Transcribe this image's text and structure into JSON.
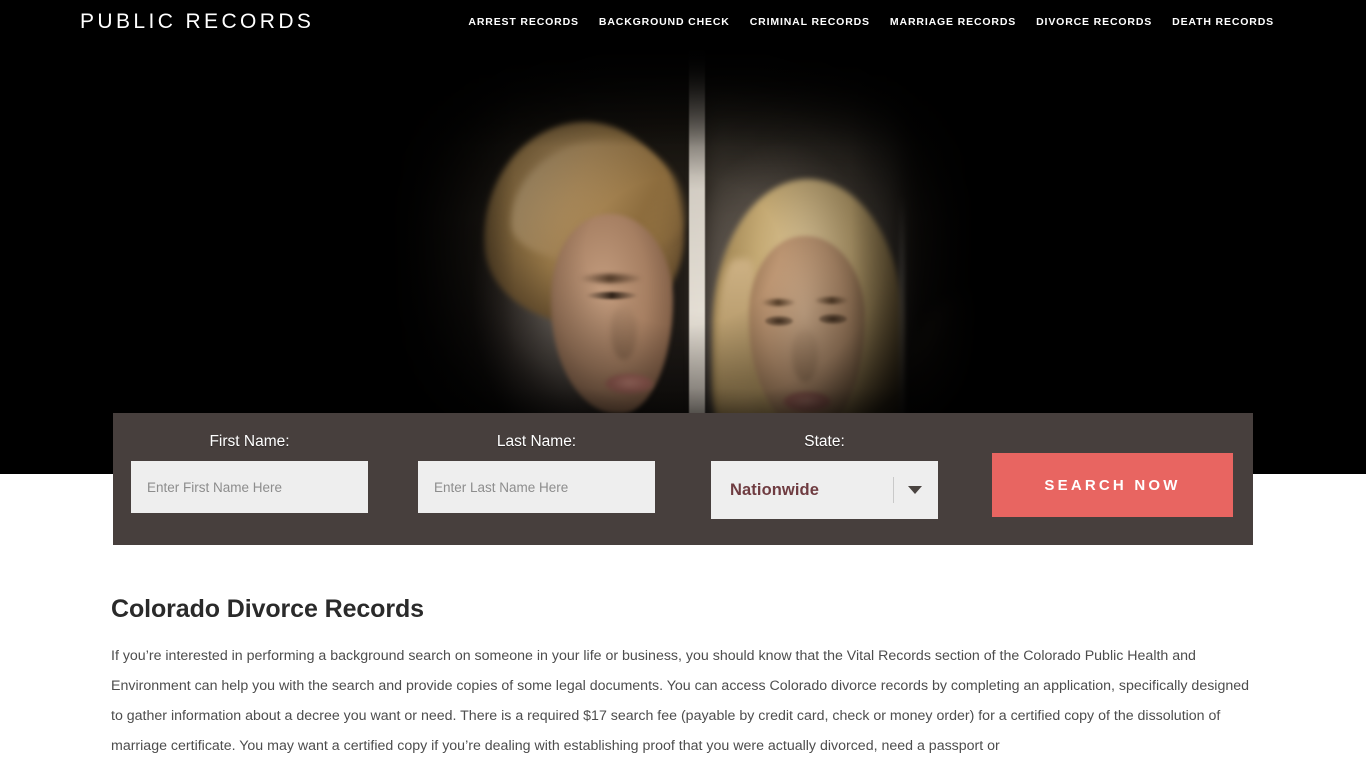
{
  "header": {
    "brand": "PUBLIC RECORDS",
    "nav": [
      {
        "label": "ARREST RECORDS"
      },
      {
        "label": "BACKGROUND CHECK"
      },
      {
        "label": "CRIMINAL RECORDS"
      },
      {
        "label": "MARRIAGE RECORDS"
      },
      {
        "label": "DIVORCE RECORDS"
      },
      {
        "label": "DEATH RECORDS"
      }
    ]
  },
  "hero": {
    "image_alt": "Couple separated by a wall divider, divorce theme"
  },
  "search_form": {
    "first_name": {
      "label": "First Name:",
      "placeholder": "Enter First Name Here",
      "value": ""
    },
    "last_name": {
      "label": "Last Name:",
      "placeholder": "Enter Last Name Here",
      "value": ""
    },
    "state": {
      "label": "State:",
      "selected": "Nationwide",
      "arrow_icon": "chevron-down-icon"
    },
    "submit_label": "SEARCH NOW"
  },
  "main": {
    "title": "Colorado Divorce Records",
    "paragraph": "If you’re interested in performing a background search on someone in your life or business, you should know that the Vital Records section of the Colorado Public Health and Environment can help you with the search and provide copies of some legal documents. You can access Colorado divorce records by completing an application, specifically designed to gather information about a decree you want or need. There is a required $17 search fee (payable by credit card, check or money order) for a certified copy of the dissolution of marriage certificate. You may want a certified copy if you’re dealing with establishing proof that you were actually divorced, need a passport or"
  },
  "colors": {
    "header_bg": "#000000",
    "panel_bg": "#473f3d",
    "accent_button": "#e86561",
    "input_bg": "#eeeeee",
    "select_text": "#6f3c41",
    "body_text": "#4d4d4d",
    "title_text": "#2a2a2a"
  }
}
